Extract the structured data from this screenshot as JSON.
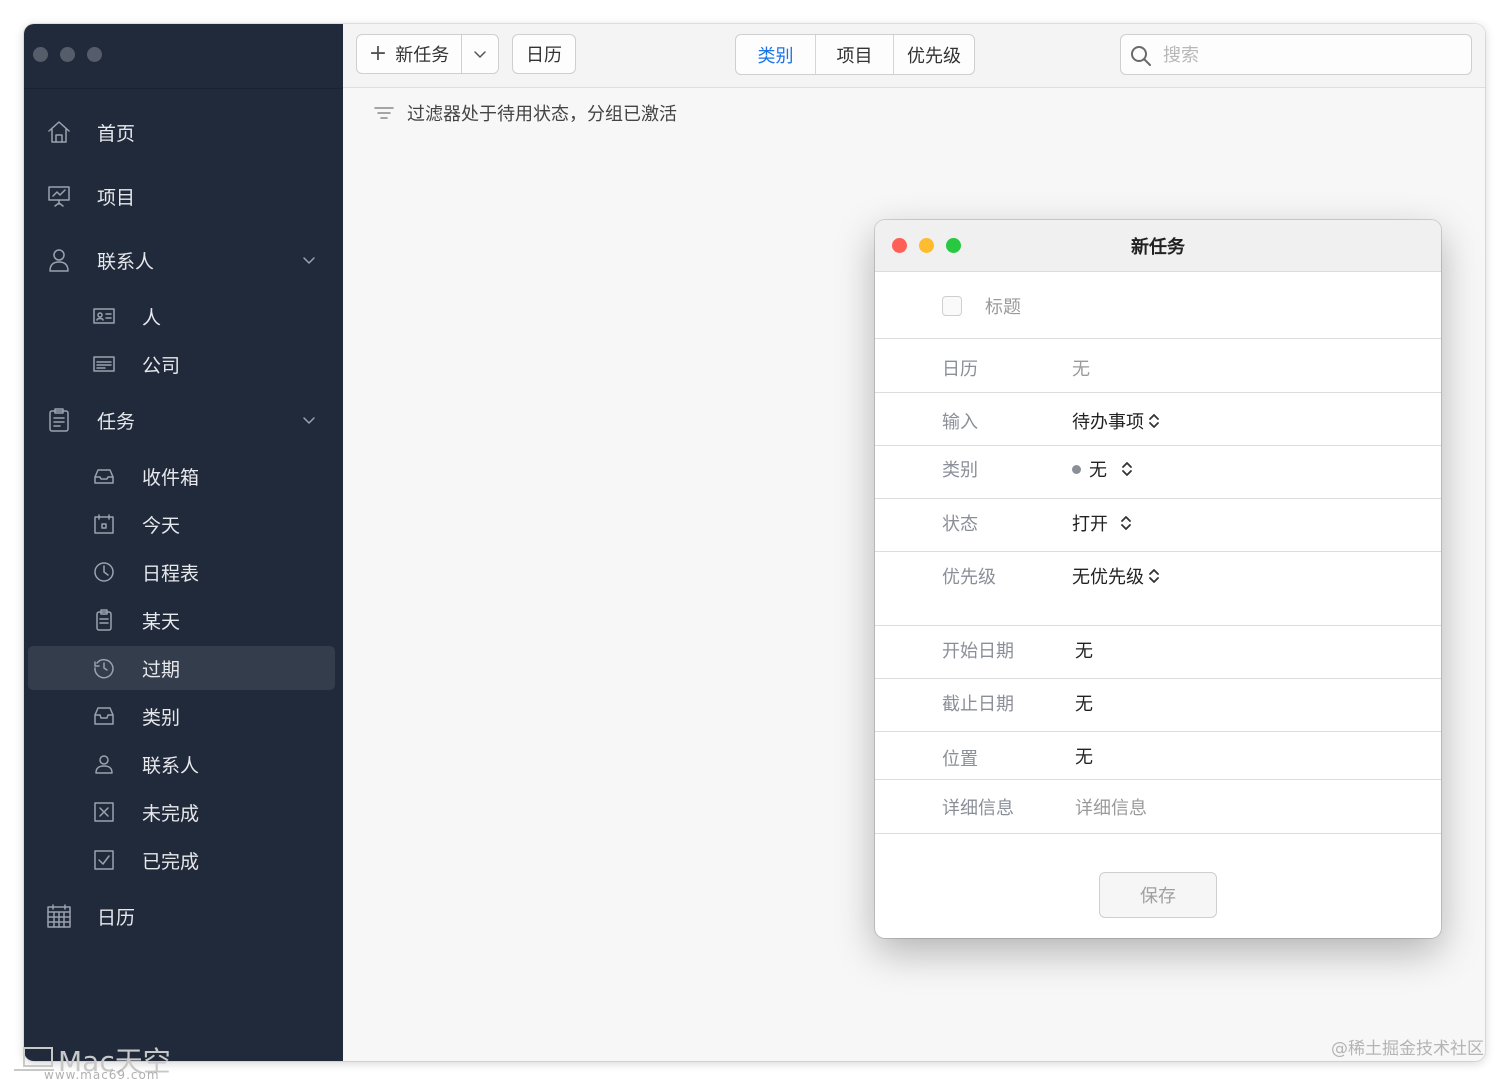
{
  "sidebar": {
    "items": [
      {
        "label": "首页",
        "icon": "home-icon"
      },
      {
        "label": "项目",
        "icon": "presentation-board-icon"
      },
      {
        "label": "联系人",
        "icon": "person-icon"
      },
      {
        "label": "人",
        "icon": "id-card-icon"
      },
      {
        "label": "公司",
        "icon": "business-card-icon"
      },
      {
        "label": "任务",
        "icon": "clipboard-list-icon"
      },
      {
        "label": "收件箱",
        "icon": "inbox-tray-icon"
      },
      {
        "label": "今天",
        "icon": "calendar-day-icon"
      },
      {
        "label": "日程表",
        "icon": "clock-icon"
      },
      {
        "label": "某天",
        "icon": "clipboard-icon"
      },
      {
        "label": "过期",
        "icon": "clock-history-icon"
      },
      {
        "label": "类别",
        "icon": "tray-icon"
      },
      {
        "label": "联系人",
        "icon": "person-icon"
      },
      {
        "label": "未完成",
        "icon": "x-box-icon"
      },
      {
        "label": "已完成",
        "icon": "check-box-icon"
      },
      {
        "label": "日历",
        "icon": "calendar-grid-icon"
      }
    ]
  },
  "toolbar": {
    "new_task": "新任务",
    "calendar": "日历",
    "segments": [
      "类别",
      "项目",
      "优先级"
    ],
    "search_placeholder": "搜索"
  },
  "filter_status": "过滤器处于待用状态，分组已激活",
  "dialog": {
    "title": "新任务",
    "title_placeholder": "标题",
    "fields": [
      {
        "key": "日历",
        "value": "无"
      },
      {
        "key": "输入",
        "value": "待办事项"
      },
      {
        "key": "类别",
        "value": "无"
      },
      {
        "key": "状态",
        "value": "打开"
      },
      {
        "key": "优先级",
        "value": "无优先级"
      },
      {
        "key": "开始日期",
        "value": "无"
      },
      {
        "key": "截止日期",
        "value": "无"
      },
      {
        "key": "位置",
        "value": "无"
      },
      {
        "key": "详细信息",
        "value": "详细信息"
      }
    ],
    "save": "保存"
  },
  "watermarks": {
    "left_brand": "Mac天空",
    "left_url": "www.mac69.com",
    "right": "@稀土掘金技术社区"
  },
  "colors": {
    "sidebar_bg": "#212a3a",
    "accent": "#1a73e8",
    "close": "#fe5f57",
    "minimize": "#febc2e",
    "zoom": "#28c840"
  }
}
